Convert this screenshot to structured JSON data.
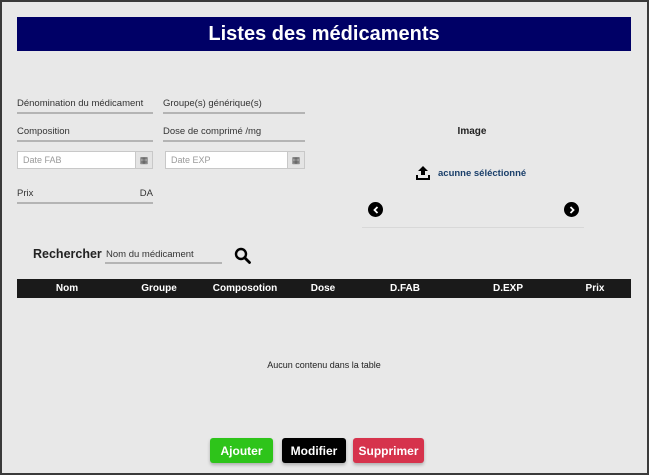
{
  "page": {
    "title": "Listes des médicaments"
  },
  "form": {
    "denomination_label": "Dénomination du médicament",
    "groupe_label": "Groupe(s) générique(s)",
    "composition_label": "Composition",
    "dose_label": "Dose de comprimé /mg",
    "date_fab_placeholder": "Date FAB",
    "date_exp_placeholder": "Date EXP",
    "prix_label": "Prix",
    "prix_suffix": "DA"
  },
  "image_panel": {
    "label": "Image",
    "upload_text": "acunne séléctionné"
  },
  "search": {
    "label": "Rechercher",
    "placeholder": "Nom du médicament"
  },
  "table": {
    "columns": [
      "Nom",
      "Groupe",
      "Composotion",
      "Dose",
      "D.FAB",
      "D.EXP",
      "Prix"
    ],
    "empty_message": "Aucun contenu dans la table"
  },
  "actions": {
    "add_label": "Ajouter",
    "edit_label": "Modifier",
    "delete_label": "Supprimer"
  },
  "colors": {
    "title_bar": "#000066",
    "add": "#2ec41a",
    "edit": "#000000",
    "delete": "#d6334c"
  }
}
